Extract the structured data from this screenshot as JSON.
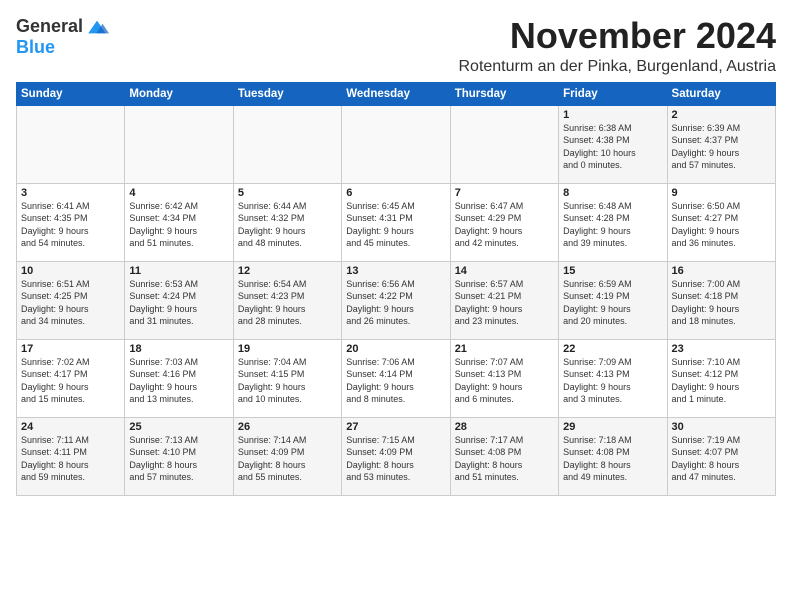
{
  "logo": {
    "general": "General",
    "blue": "Blue"
  },
  "header": {
    "month_title": "November 2024",
    "subtitle": "Rotenturm an der Pinka, Burgenland, Austria"
  },
  "columns": [
    "Sunday",
    "Monday",
    "Tuesday",
    "Wednesday",
    "Thursday",
    "Friday",
    "Saturday"
  ],
  "weeks": [
    [
      {
        "day": "",
        "info": ""
      },
      {
        "day": "",
        "info": ""
      },
      {
        "day": "",
        "info": ""
      },
      {
        "day": "",
        "info": ""
      },
      {
        "day": "",
        "info": ""
      },
      {
        "day": "1",
        "info": "Sunrise: 6:38 AM\nSunset: 4:38 PM\nDaylight: 10 hours\nand 0 minutes."
      },
      {
        "day": "2",
        "info": "Sunrise: 6:39 AM\nSunset: 4:37 PM\nDaylight: 9 hours\nand 57 minutes."
      }
    ],
    [
      {
        "day": "3",
        "info": "Sunrise: 6:41 AM\nSunset: 4:35 PM\nDaylight: 9 hours\nand 54 minutes."
      },
      {
        "day": "4",
        "info": "Sunrise: 6:42 AM\nSunset: 4:34 PM\nDaylight: 9 hours\nand 51 minutes."
      },
      {
        "day": "5",
        "info": "Sunrise: 6:44 AM\nSunset: 4:32 PM\nDaylight: 9 hours\nand 48 minutes."
      },
      {
        "day": "6",
        "info": "Sunrise: 6:45 AM\nSunset: 4:31 PM\nDaylight: 9 hours\nand 45 minutes."
      },
      {
        "day": "7",
        "info": "Sunrise: 6:47 AM\nSunset: 4:29 PM\nDaylight: 9 hours\nand 42 minutes."
      },
      {
        "day": "8",
        "info": "Sunrise: 6:48 AM\nSunset: 4:28 PM\nDaylight: 9 hours\nand 39 minutes."
      },
      {
        "day": "9",
        "info": "Sunrise: 6:50 AM\nSunset: 4:27 PM\nDaylight: 9 hours\nand 36 minutes."
      }
    ],
    [
      {
        "day": "10",
        "info": "Sunrise: 6:51 AM\nSunset: 4:25 PM\nDaylight: 9 hours\nand 34 minutes."
      },
      {
        "day": "11",
        "info": "Sunrise: 6:53 AM\nSunset: 4:24 PM\nDaylight: 9 hours\nand 31 minutes."
      },
      {
        "day": "12",
        "info": "Sunrise: 6:54 AM\nSunset: 4:23 PM\nDaylight: 9 hours\nand 28 minutes."
      },
      {
        "day": "13",
        "info": "Sunrise: 6:56 AM\nSunset: 4:22 PM\nDaylight: 9 hours\nand 26 minutes."
      },
      {
        "day": "14",
        "info": "Sunrise: 6:57 AM\nSunset: 4:21 PM\nDaylight: 9 hours\nand 23 minutes."
      },
      {
        "day": "15",
        "info": "Sunrise: 6:59 AM\nSunset: 4:19 PM\nDaylight: 9 hours\nand 20 minutes."
      },
      {
        "day": "16",
        "info": "Sunrise: 7:00 AM\nSunset: 4:18 PM\nDaylight: 9 hours\nand 18 minutes."
      }
    ],
    [
      {
        "day": "17",
        "info": "Sunrise: 7:02 AM\nSunset: 4:17 PM\nDaylight: 9 hours\nand 15 minutes."
      },
      {
        "day": "18",
        "info": "Sunrise: 7:03 AM\nSunset: 4:16 PM\nDaylight: 9 hours\nand 13 minutes."
      },
      {
        "day": "19",
        "info": "Sunrise: 7:04 AM\nSunset: 4:15 PM\nDaylight: 9 hours\nand 10 minutes."
      },
      {
        "day": "20",
        "info": "Sunrise: 7:06 AM\nSunset: 4:14 PM\nDaylight: 9 hours\nand 8 minutes."
      },
      {
        "day": "21",
        "info": "Sunrise: 7:07 AM\nSunset: 4:13 PM\nDaylight: 9 hours\nand 6 minutes."
      },
      {
        "day": "22",
        "info": "Sunrise: 7:09 AM\nSunset: 4:13 PM\nDaylight: 9 hours\nand 3 minutes."
      },
      {
        "day": "23",
        "info": "Sunrise: 7:10 AM\nSunset: 4:12 PM\nDaylight: 9 hours\nand 1 minute."
      }
    ],
    [
      {
        "day": "24",
        "info": "Sunrise: 7:11 AM\nSunset: 4:11 PM\nDaylight: 8 hours\nand 59 minutes."
      },
      {
        "day": "25",
        "info": "Sunrise: 7:13 AM\nSunset: 4:10 PM\nDaylight: 8 hours\nand 57 minutes."
      },
      {
        "day": "26",
        "info": "Sunrise: 7:14 AM\nSunset: 4:09 PM\nDaylight: 8 hours\nand 55 minutes."
      },
      {
        "day": "27",
        "info": "Sunrise: 7:15 AM\nSunset: 4:09 PM\nDaylight: 8 hours\nand 53 minutes."
      },
      {
        "day": "28",
        "info": "Sunrise: 7:17 AM\nSunset: 4:08 PM\nDaylight: 8 hours\nand 51 minutes."
      },
      {
        "day": "29",
        "info": "Sunrise: 7:18 AM\nSunset: 4:08 PM\nDaylight: 8 hours\nand 49 minutes."
      },
      {
        "day": "30",
        "info": "Sunrise: 7:19 AM\nSunset: 4:07 PM\nDaylight: 8 hours\nand 47 minutes."
      }
    ]
  ]
}
